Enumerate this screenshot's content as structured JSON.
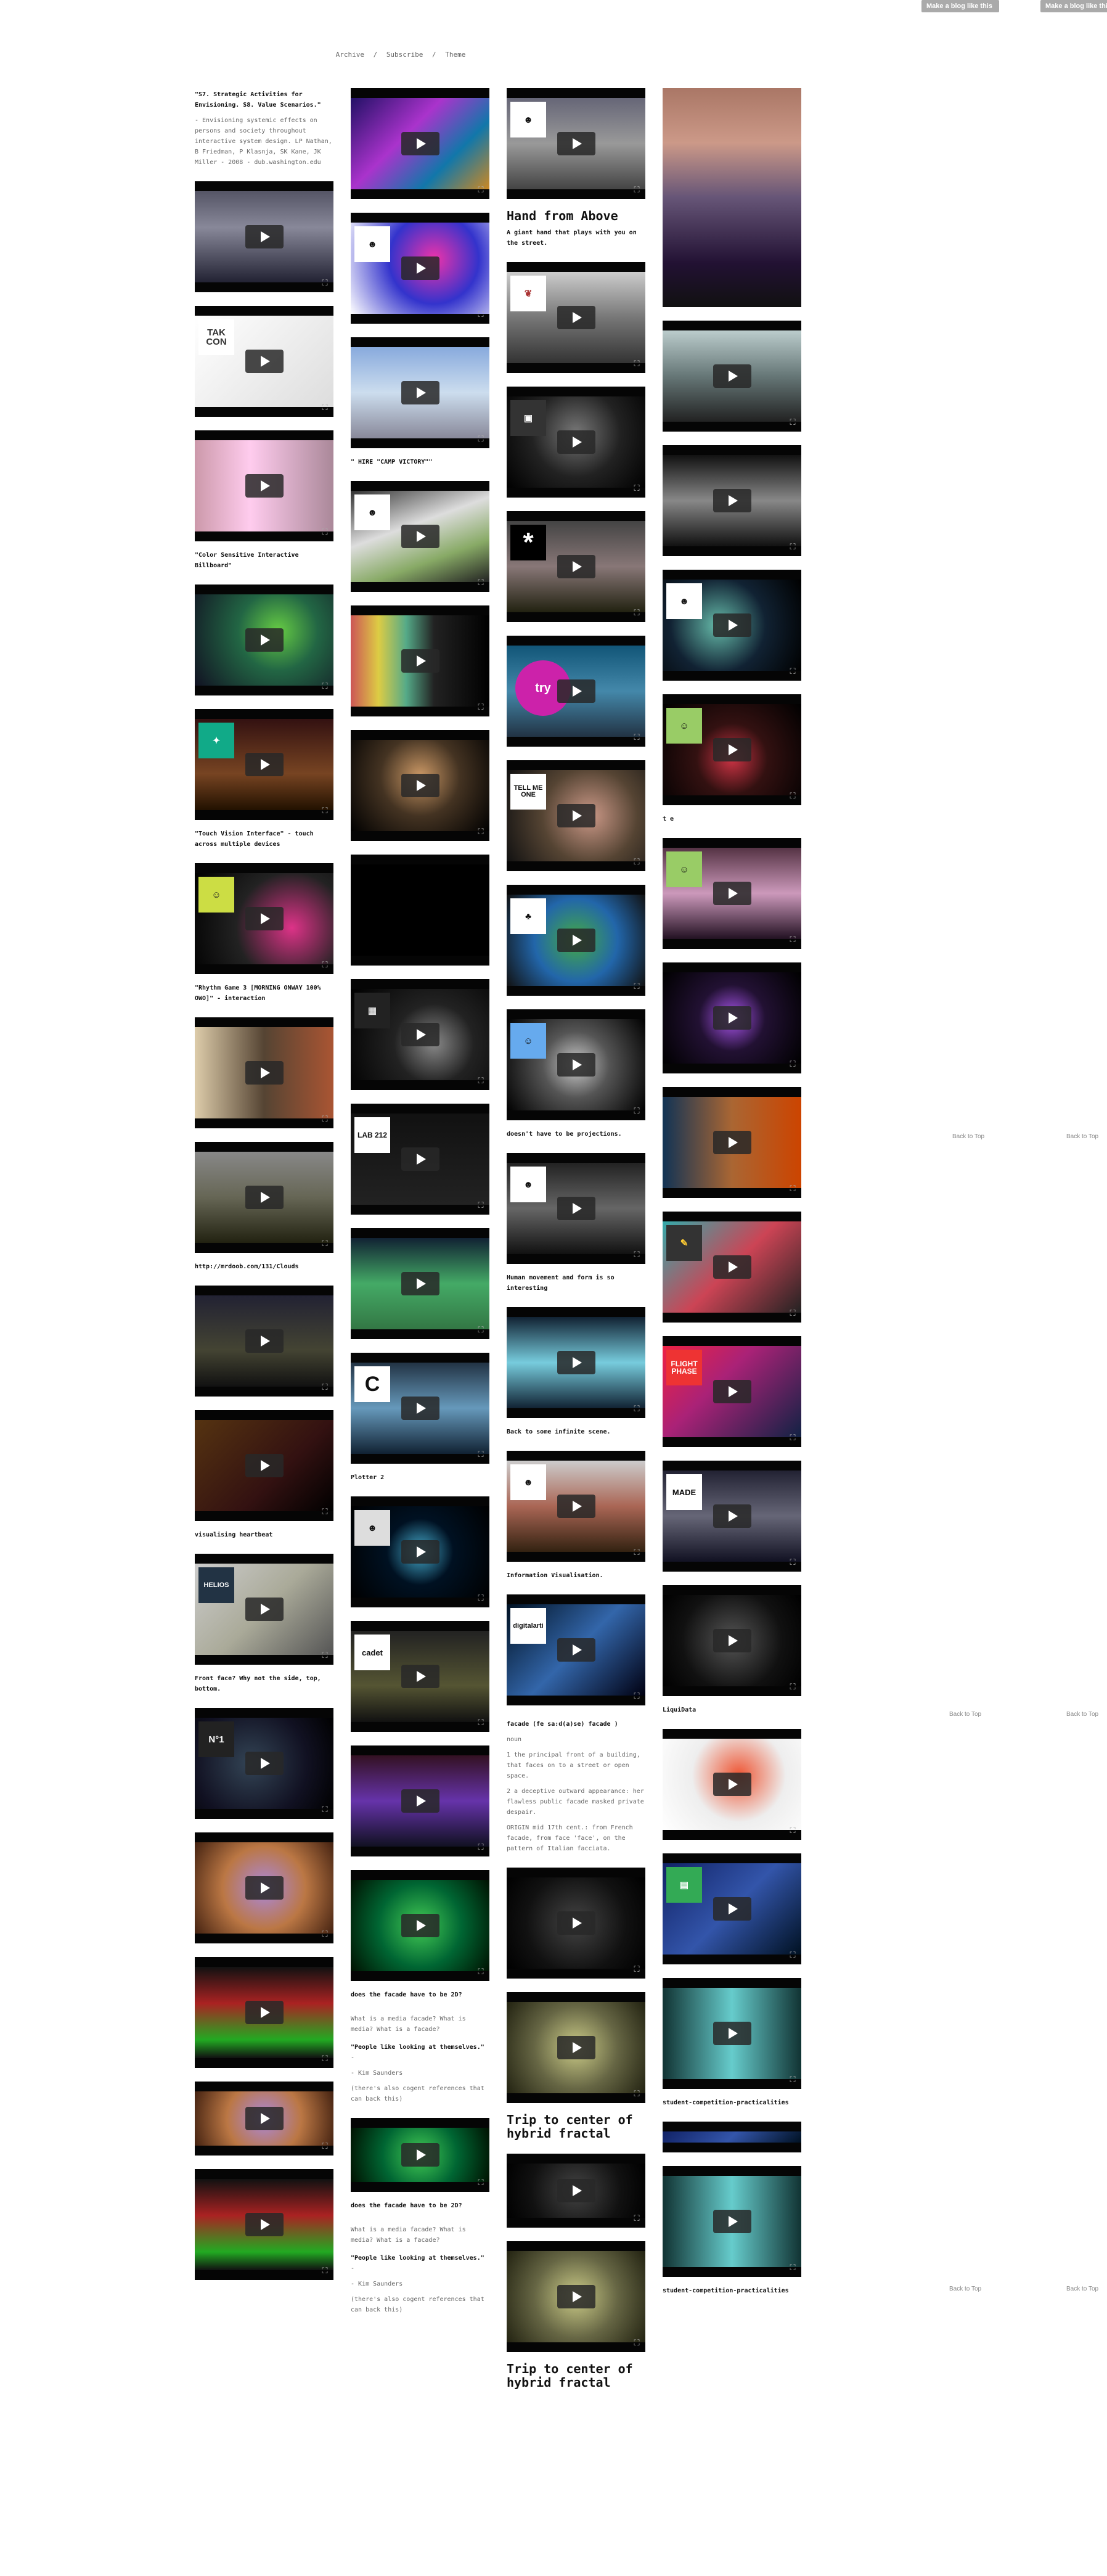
{
  "top_buttons": [
    "Make a blog like this",
    "Make a blog like this"
  ],
  "nav": [
    "Archive",
    "/",
    "Subscribe",
    "/",
    "Theme"
  ],
  "back_to_top": "Back to Top",
  "icons": {
    "play": "play-icon",
    "fullscreen": "fullscreen-icon"
  },
  "col1": {
    "intro_title": "\"S7. Strategic Activities for Envisioning. S8. Value Scenarios.\"",
    "intro_body": "- Envisioning systemic effects on persons and society throughout interactive system design. LP Nathan, B Friedman, P Klasnja, SK Kane, JK Miller - 2008 - dub.washington.edu",
    "caps": [
      "\"Color Sensitive Interactive Billboard\"",
      "\"Touch Vision Interface\" - touch across multiple devices",
      "\"Rhythm Game 3 [MORNING ONWAY 100% OWO]\" - interaction",
      "http://mrdoob.com/131/Clouds",
      "visualising heartbeat",
      "Front face? Why not the side, top, bottom."
    ]
  },
  "col2": {
    "caps": [
      "\" HIRE \"CAMP VICTORY\"\"",
      "Plotter 2"
    ],
    "q_title": "does the facade have to be 2D?",
    "q_body": "What is a media facade? What is media? What is a facade?",
    "quote": "\"People like looking at themselves.\"",
    "quote_dash": "-",
    "quote_by": "- Kim Saunders",
    "quote_note": "(there's also cogent references that can back this)"
  },
  "col3": {
    "post_title": "Hand from Above",
    "post_caption": "A giant hand that plays with you on the street.",
    "caps": [
      "doesn't have to be projections.",
      "Human movement and form is so interesting",
      "Back to some infinite scene.",
      "Information Visualisation."
    ],
    "facade_title": "facade (fe sa:d(a)se) facade )",
    "facade_noun": "noun",
    "facade_def1": "1 the principal front of a building, that faces on to a street or open space.",
    "facade_def2": "2 a deceptive outward appearance: her flawless public facade masked private despair.",
    "facade_origin": "ORIGIN mid 17th cent.: from French facade, from face 'face', on the pattern of Italian facciata.",
    "fractal_title": "Trip to center of hybrid fractal"
  },
  "col4": {
    "caps": [
      "t e",
      "LiquiData",
      "student-competition-practicalities"
    ]
  },
  "thumbs": {
    "takcon": "TAK CON",
    "lab": "LAB 212",
    "tell": "TELL ME ONE",
    "digital": "digitalarti",
    "flight": "FLIGHT PHASE",
    "made": "MADE",
    "cadet": "cadet",
    "helios": "HELIOS",
    "try": "try",
    "no1": "N°1"
  }
}
